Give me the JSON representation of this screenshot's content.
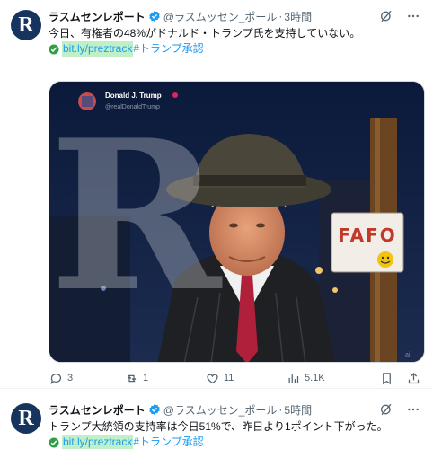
{
  "tweets": [
    {
      "avatar_letter": "R",
      "name": "ラスムセンレポート",
      "handle": "@ラスムッセン_ポール",
      "separator": "·",
      "time": "3時間",
      "text": "今日、有権者の48%がドナルド・トランプ氏を支持していない。",
      "link": "bit.ly/preztrack",
      "hashtag": "#トランプ承認",
      "media": {
        "embedded_name": "Donald J. Trump",
        "embedded_handle": "@realDonaldTrump",
        "sign_text": "FAFO",
        "watermark_letter": "R",
        "corner_mark": "ai"
      },
      "stats": {
        "replies": "3",
        "retweets": "1",
        "likes": "11",
        "views": "5.1K"
      }
    },
    {
      "avatar_letter": "R",
      "name": "ラスムセンレポート",
      "handle": "@ラスムッセン_ポール",
      "separator": "·",
      "time": "5時間",
      "text": "トランプ大統領の支持率は今日51%で、昨日より1ポイント下がった。",
      "link": "bit.ly/preztrack",
      "hashtag": "#トランプ承認"
    }
  ],
  "colors": {
    "accent": "#1d9bf0",
    "link_highlight": "#bff0c7",
    "muted_text": "#536471",
    "avatar_bg": "#17345f",
    "verified": "#1d9bf0"
  },
  "icons": {
    "verified": "verified-badge-icon",
    "grok": "grok-icon",
    "more": "more-dots-icon",
    "check": "green-check-icon",
    "reply": "reply-icon",
    "retweet": "retweet-icon",
    "like": "heart-icon",
    "views": "views-icon",
    "bookmark": "bookmark-icon",
    "share": "share-icon"
  }
}
